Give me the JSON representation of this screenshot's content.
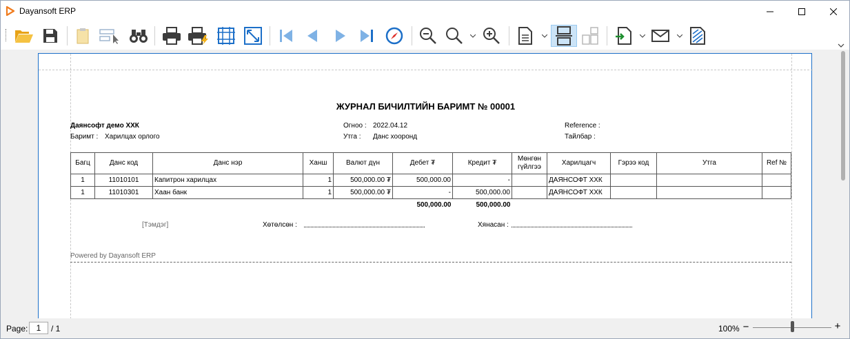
{
  "window": {
    "title": "Dayansoft ERP",
    "accent": "#1c6fc8"
  },
  "toolbar": {
    "buttons": [
      "open-folder-icon",
      "save-icon",
      "parameters-icon",
      "editing-fields-icon",
      "find-icon",
      "print-icon",
      "quick-print-icon",
      "page-setup-icon",
      "scale-icon",
      "first-page-icon",
      "previous-page-icon",
      "next-page-icon",
      "last-page-icon",
      "navigation-icon",
      "zoom-out-icon",
      "zoom-icon",
      "zoom-in-icon",
      "view-mode-icon",
      "multiple-pages-icon",
      "page-layout-icon",
      "export-icon",
      "send-email-icon",
      "watermark-icon"
    ]
  },
  "document": {
    "title": "ЖУРНАЛ БИЧИЛТИЙН БАРИМТ  № 00001",
    "company": "Даянсофт демо ХХК",
    "doc_type_label": "Баримт :",
    "doc_type_value": "Харилцах орлого",
    "date_label": "Огноо :",
    "date_value": "2022.04.12",
    "description_label": "Утга :",
    "description_value": "Данс хооронд",
    "reference_label": "Reference :",
    "note_label": "Тайлбар :",
    "table": {
      "headers": [
        "Багц",
        "Данс код",
        "Данс нэр",
        "Ханш",
        "Валют дүн",
        "Дебет ₮",
        "Кредит ₮",
        "Мөнгөн гүйлгээ",
        "Харилцагч",
        "Гэрээ код",
        "Утга",
        "Ref №"
      ],
      "rows": [
        [
          "1",
          "11010101",
          "Капитрон харилцах",
          "1",
          "500,000.00 ₮",
          "500,000.00",
          "-",
          "",
          "ДАЯНСОФТ ХХК",
          "",
          "",
          ""
        ],
        [
          "1",
          "11010301",
          "Хаан банк",
          "1",
          "500,000.00 ₮",
          "-",
          "500,000.00",
          "",
          "ДАЯНСОФТ ХХК",
          "",
          "",
          ""
        ]
      ],
      "total_debit": "500,000.00",
      "total_credit": "500,000.00"
    },
    "stamp_label": "[Тэмдэг]",
    "prepared_label": "Хөтөлсөн :",
    "checked_label": "Хянасан :",
    "powered_by": "Powered by Dayansoft ERP"
  },
  "statusbar": {
    "page_label": "Page:",
    "page_value": "1",
    "page_total": "/ 1",
    "zoom_label": "100%",
    "zoom_fraction": 0.5
  }
}
